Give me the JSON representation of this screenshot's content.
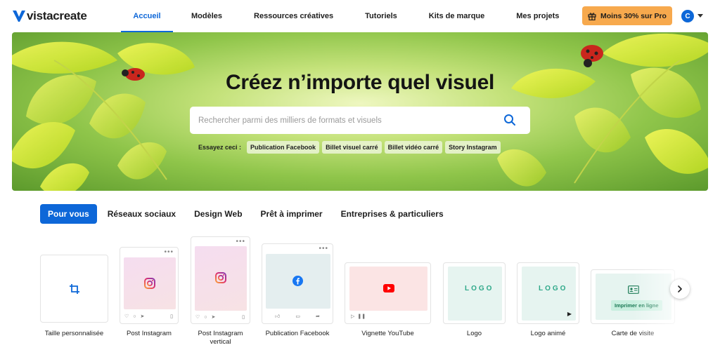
{
  "header": {
    "brand": "vistacreate",
    "nav": [
      "Accueil",
      "Modèles",
      "Ressources créatives",
      "Tutoriels",
      "Kits de marque",
      "Mes projets"
    ],
    "active_nav": 0,
    "promo_label": "Moins 30% sur Pro",
    "avatar_initial": "C"
  },
  "hero": {
    "title": "Créez n’importe quel visuel",
    "search_placeholder": "Rechercher parmi des milliers de formats et visuels",
    "suggest_label": "Essayez ceci :",
    "suggestions": [
      "Publication Facebook",
      "Billet visuel carré",
      "Billet vidéo carré",
      "Story Instagram"
    ]
  },
  "tabs": {
    "items": [
      "Pour vous",
      "Réseaux sociaux",
      "Design Web",
      "Prêt à imprimer",
      "Entreprises & particuliers"
    ],
    "active": 0
  },
  "cards": {
    "custom_size": "Taille personnalisée",
    "instagram_post": "Post Instagram",
    "instagram_vertical": "Post Instagram vertical",
    "facebook_post": "Publication Facebook",
    "youtube_thumbnail": "Vignette YouTube",
    "logo": "Logo",
    "animated_logo": "Logo animé",
    "business_card": "Carte de visite",
    "logo_mark": "LOGO",
    "print_badge": "Imprimer en ligne"
  },
  "colors": {
    "accent": "#0d67d8",
    "promo": "#f7a94d"
  }
}
